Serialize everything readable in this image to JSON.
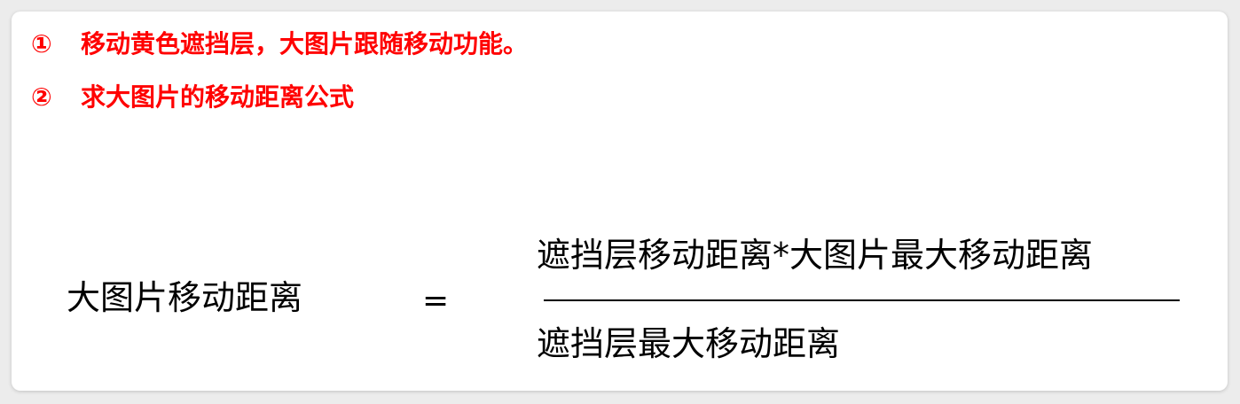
{
  "points": [
    {
      "marker": "①",
      "text": "移动黄色遮挡层，大图片跟随移动功能。"
    },
    {
      "marker": "②",
      "text": "求大图片的移动距离公式"
    }
  ],
  "formula": {
    "left": "大图片移动距离",
    "equals": "=",
    "numerator": "遮挡层移动距离*大图片最大移动距离",
    "denominator": "遮挡层最大移动距离"
  },
  "colors": {
    "accent": "#ff0000",
    "text": "#000000",
    "card": "#ffffff",
    "background": "#ececec"
  }
}
